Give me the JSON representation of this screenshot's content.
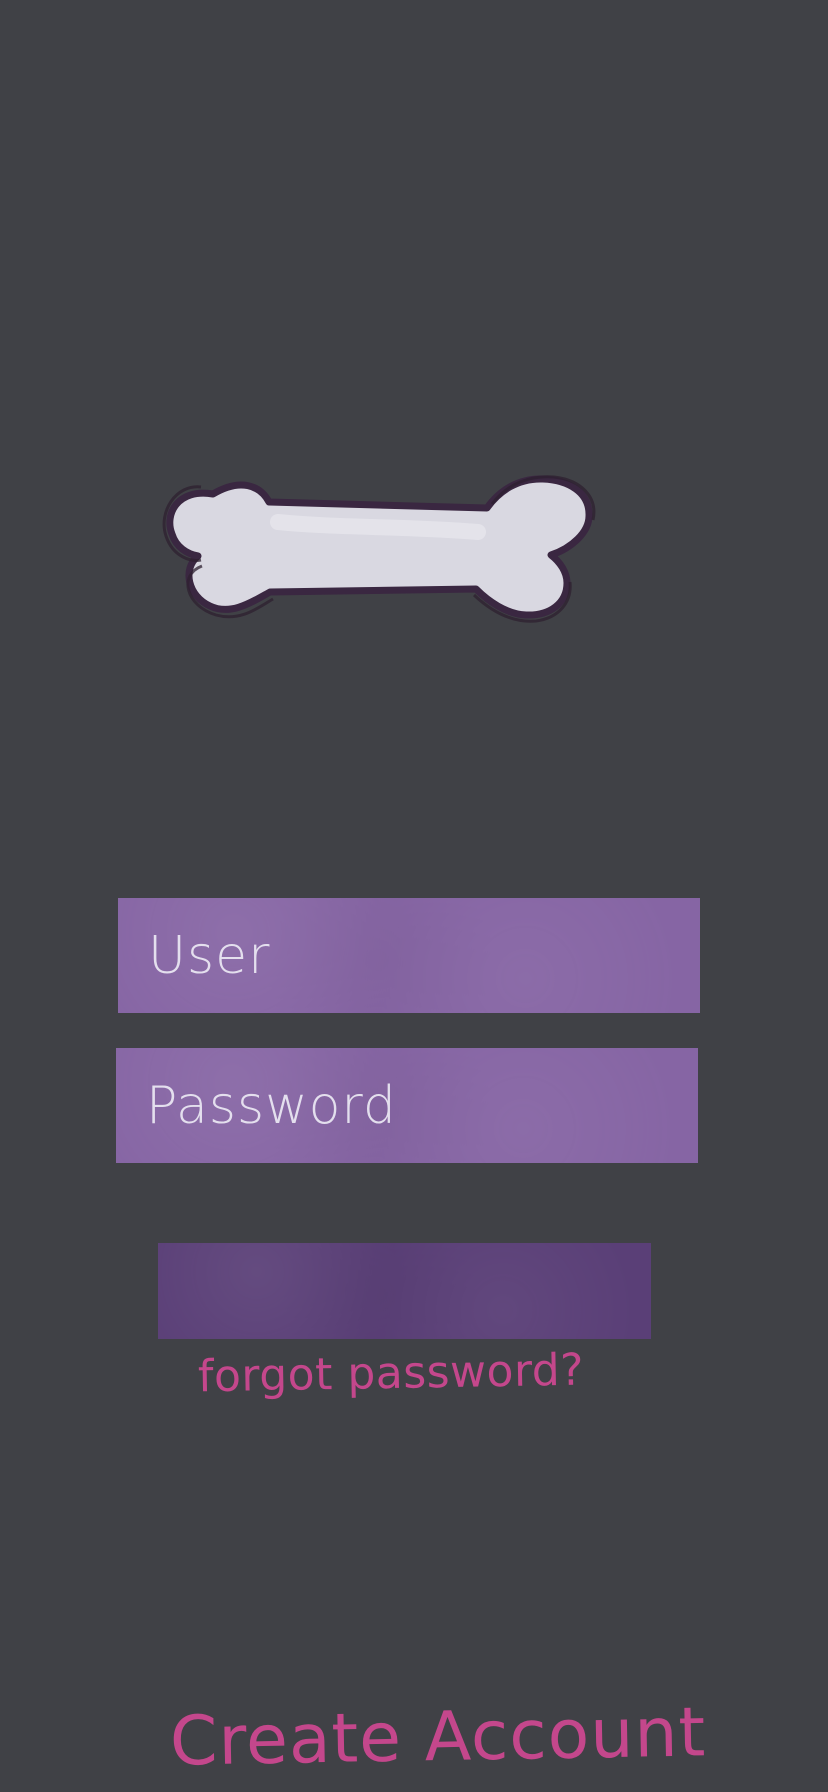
{
  "logo": {
    "icon": "bone-icon",
    "colors": {
      "fill": "#d9d8e1",
      "outline": "#3a2741"
    }
  },
  "form": {
    "username_placeholder": "User",
    "password_placeholder": "Password",
    "field_color": "#8665a4",
    "button_color": "#5a3f77"
  },
  "links": {
    "forgot_password": "forgot password?",
    "create_account": "Create Account",
    "color": "#c4478c"
  }
}
